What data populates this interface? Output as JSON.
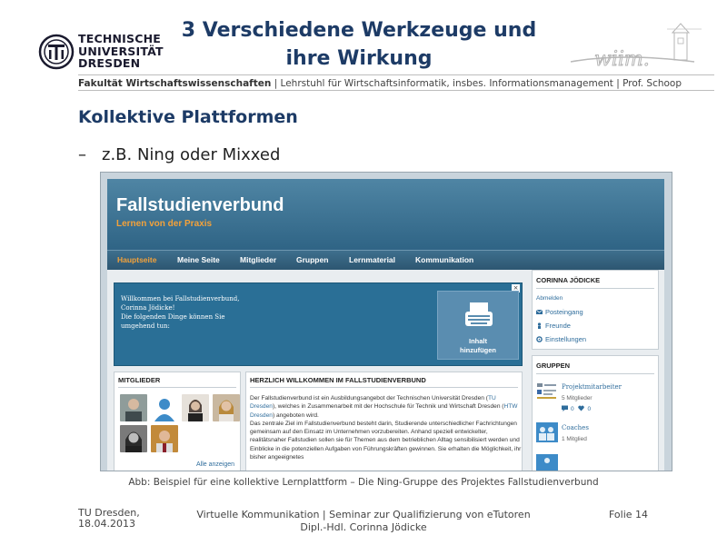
{
  "header": {
    "logo_lines": [
      "TECHNISCHE",
      "UNIVERSITÄT",
      "DRESDEN"
    ],
    "title_line1": "3 Verschiedene Werkzeuge und",
    "title_line2": "ihre Wirkung",
    "faculty_bold": "Fakultät Wirtschaftswissenschaften",
    "faculty_rest": " | Lehrstuhl für Wirtschaftsinformatik, insbes. Informationsmanagement | Prof. Schoop"
  },
  "content": {
    "heading": "Kollektive Plattformen",
    "bullet_dash": "–",
    "bullet_text": "z.B. Ning oder Mixxed",
    "caption": "Abb: Beispiel für eine kollektive Lernplattform – Die Ning-Gruppe des Projektes Fallstudienverbund"
  },
  "screenshot": {
    "site_title": "Fallstudienverbund",
    "site_subtitle": "Lernen von der Praxis",
    "nav": [
      "Hauptseite",
      "Meine Seite",
      "Mitglieder",
      "Gruppen",
      "Lernmaterial",
      "Kommunikation"
    ],
    "welcome": {
      "line1": "Willkommen bei Fallstudienverbund,",
      "line2": "Corinna Jödicke!",
      "line3": "Die folgenden Dinge können Sie",
      "line4": "umgehend tun:",
      "close": "×",
      "button_line1": "Inhalt",
      "button_line2": "hinzufügen"
    },
    "members": {
      "title": "MITGLIEDER",
      "all_link": "Alle anzeigen"
    },
    "article": {
      "title": "HERZLICH WILLKOMMEN IM FALLSTUDIENVERBUND",
      "p1_a": "Der Fallstudienverbund ist ein Ausbildungsangebot der Technischen Universität Dresden (",
      "p1_link1": "TU Dresden",
      "p1_b": "), welches in Zusammenarbeit mit der Hochschule für Technik und Wirtschaft Dresden (",
      "p1_link2": "HTW Dresden",
      "p1_c": ") angeboten wird.",
      "p2": "Das zentrale Ziel im Fallstudienverbund besteht darin, Studierende unterschiedlicher Fachrichtungen gemeinsam auf den Einsatz im Unternehmen vorzubereiten. Anhand speziell entwickelter, realitätsnaher Fallstudien sollen sie für Themen aus dem betrieblichen Alltag sensibilisiert werden und Einblicke in die potenziellen Aufgaben von Führungskräften gewinnen. Sie erhalten die Möglichkeit, ihr bisher angeeignetes"
    },
    "profile": {
      "name": "CORINNA JÖDICKE",
      "logout": "Abmelden",
      "links": [
        "Posteingang",
        "Freunde",
        "Einstellungen"
      ]
    },
    "groups": {
      "title": "GRUPPEN",
      "g1_name": "Projektmitarbeiter",
      "g1_meta": "5 Mitglieder",
      "g1_count_a": "0",
      "g1_count_b": "0",
      "g2_name": "Coaches",
      "g2_meta": "1 Mitglied"
    },
    "colors": {
      "header_blue": "#2f6485",
      "accent_orange": "#f4a23a",
      "link_blue": "#2f6d9c"
    }
  },
  "footer": {
    "left_line1": "TU Dresden,",
    "left_line2": "18.04.2013",
    "center_line1": "Virtuelle Kommunikation | Seminar zur Qualifizierung von eTutoren",
    "center_line2": "Dipl.-Hdl. Corinna Jödicke",
    "right": "Folie 14"
  }
}
